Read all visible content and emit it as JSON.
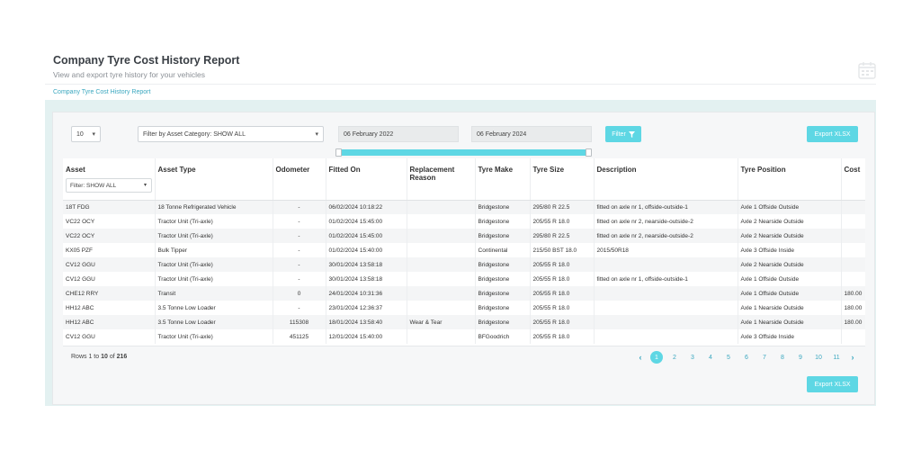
{
  "header": {
    "title": "Company Tyre Cost History Report",
    "subtitle": "View and export tyre history for your vehicles"
  },
  "breadcrumb": "Company Tyre Cost History Report",
  "controls": {
    "page_size": "10",
    "category_filter": "Filter by Asset Category: SHOW ALL",
    "start_date": "06 February 2022",
    "end_date": "06 February 2024",
    "filter_button": "Filter",
    "export_button": "Export XLSX",
    "date_slider": {
      "start_fraction": 0.0,
      "end_fraction": 1.0
    }
  },
  "table": {
    "columns": [
      "Asset",
      "Asset Type",
      "Odometer",
      "Fitted On",
      "Replacement Reason",
      "Tyre Make",
      "Tyre Size",
      "Description",
      "Tyre Position",
      "Cost"
    ],
    "asset_filter": "Filter: SHOW ALL",
    "rows": [
      [
        "18T FDG",
        "18 Tonne Refrigerated Vehicle",
        "-",
        "06/02/2024 10:18:22",
        "",
        "Bridgestone",
        "295/80 R 22.5",
        "fitted on axle nr 1, offside-outside-1",
        "Axle 1 Offside Outside",
        ""
      ],
      [
        "VC22 OCY",
        "Tractor Unit (Tri-axle)",
        "-",
        "01/02/2024 15:45:00",
        "",
        "Bridgestone",
        "205/55 R 18.0",
        "fitted on axle nr 2, nearside-outside-2",
        "Axle 2 Nearside Outside",
        ""
      ],
      [
        "VC22 OCY",
        "Tractor Unit (Tri-axle)",
        "-",
        "01/02/2024 15:45:00",
        "",
        "Bridgestone",
        "295/80 R 22.5",
        "fitted on axle nr 2, nearside-outside-2",
        "Axle 2 Nearside Outside",
        ""
      ],
      [
        "KX05 PZF",
        "Bulk Tipper",
        "-",
        "01/02/2024 15:40:00",
        "",
        "Continental",
        "215/50 BST 18.0",
        "2015/50R18",
        "Axle 3 Offside Inside",
        ""
      ],
      [
        "CV12 GGU",
        "Tractor Unit (Tri-axle)",
        "-",
        "30/01/2024 13:58:18",
        "",
        "Bridgestone",
        "205/55 R 18.0",
        "",
        "Axle 2 Nearside Outside",
        ""
      ],
      [
        "CV12 GGU",
        "Tractor Unit (Tri-axle)",
        "-",
        "30/01/2024 13:58:18",
        "",
        "Bridgestone",
        "205/55 R 18.0",
        "fitted on axle nr 1, offside-outside-1",
        "Axle 1 Offside Outside",
        ""
      ],
      [
        "CHE12 RRY",
        "Transit",
        "0",
        "24/01/2024 10:31:36",
        "",
        "Bridgestone",
        "205/55 R 18.0",
        "",
        "Axle 1 Offside Outside",
        "180.00"
      ],
      [
        "HH12 ABC",
        "3.5 Tonne Low Loader",
        "-",
        "23/01/2024 12:36:37",
        "",
        "Bridgestone",
        "205/55 R 18.0",
        "",
        "Axle 1 Nearside Outside",
        "180.00"
      ],
      [
        "HH12 ABC",
        "3.5 Tonne Low Loader",
        "115308",
        "18/01/2024 13:58:40",
        "Wear & Tear",
        "Bridgestone",
        "205/55 R 18.0",
        "",
        "Axle 1 Nearside Outside",
        "180.00"
      ],
      [
        "CV12 GGU",
        "Tractor Unit (Tri-axle)",
        "451125",
        "12/01/2024 15:40:00",
        "",
        "BFGoodrich",
        "205/55 R 18.0",
        "",
        "Axle 3 Offside Inside",
        ""
      ]
    ]
  },
  "footer": {
    "rows_prefix": "Rows 1 to ",
    "rows_shown": "10",
    "rows_of": " of ",
    "rows_total": "216",
    "pages": [
      "1",
      "2",
      "3",
      "4",
      "5",
      "6",
      "7",
      "8",
      "9",
      "10",
      "11"
    ],
    "active_page": "1",
    "prev_arrow": "‹",
    "next_arrow": "›"
  },
  "icons": {
    "calendar": "calendar-icon",
    "filter": "funnel-icon",
    "chevron": "chevron-down-icon"
  },
  "colors": {
    "accent": "#5ed7e4",
    "link": "#3aa7bf"
  }
}
